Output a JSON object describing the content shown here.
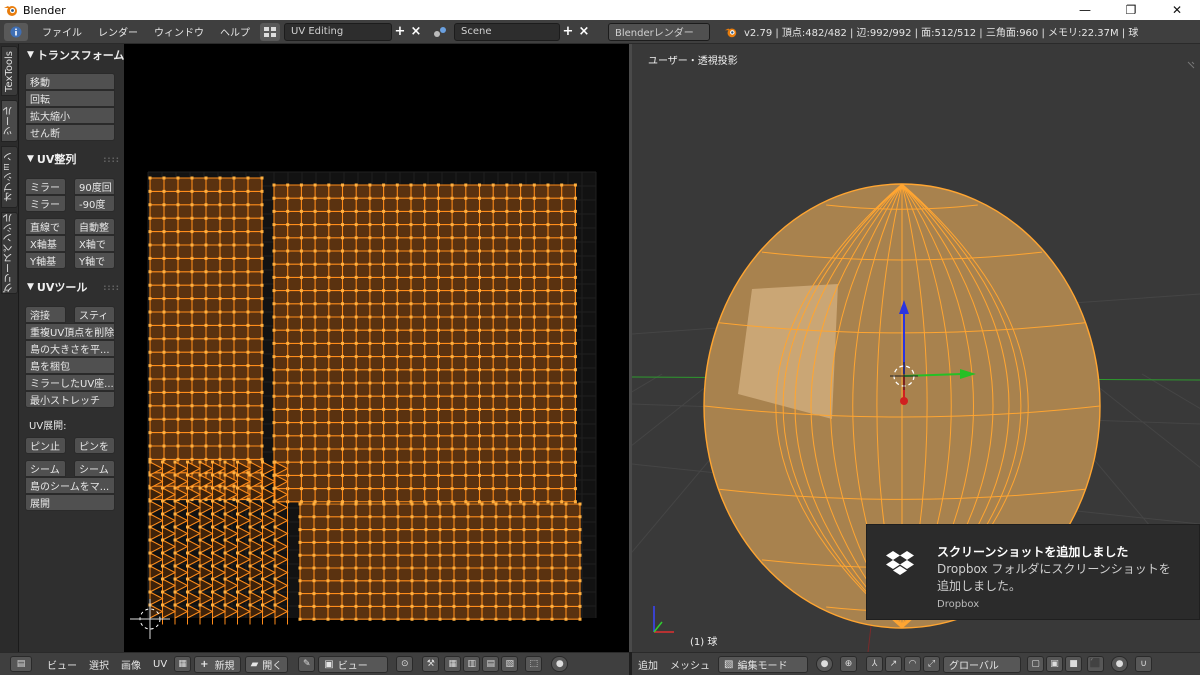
{
  "window": {
    "title": "Blender",
    "minimize": "—",
    "maximize": "❐",
    "close": "✕"
  },
  "menubar": {
    "items": [
      "ファイル",
      "レンダー",
      "ウィンドウ",
      "ヘルプ"
    ],
    "screen_layout": "UV Editing",
    "scene": "Scene",
    "engine": "Blenderレンダー",
    "stats": "v2.79 | 頂点:482/482 | 辺:992/992 | 面:512/512 | 三角面:960 | メモリ:22.37M | 球"
  },
  "tabs": [
    "TexTools",
    "ツール",
    "オプション",
    "グリースペンシル"
  ],
  "shelf": {
    "transform": {
      "title": "トランスフォーム",
      "buttons": [
        "移動",
        "回転",
        "拡大縮小",
        "せん断"
      ]
    },
    "uv_align": {
      "title": "UV整列",
      "buttons": [
        "ミラー",
        "90度回",
        "ミラー",
        "-90度",
        "直線で",
        "自動整",
        "X軸基",
        "X軸で",
        "Y軸基",
        "Y軸で"
      ]
    },
    "uv_tools": {
      "title": "UVツール",
      "buttons": [
        "溶接",
        "スティ",
        "重複UV頂点を削除",
        "島の大きさを平...",
        "島を梱包",
        "ミラーしたUV座...",
        "最小ストレッチ"
      ],
      "unwrap_label": "UV展開:",
      "unwrap_buttons": [
        "ピン止",
        "ピンを",
        "シーム",
        "シーム",
        "島のシームをマ...",
        "展開"
      ]
    }
  },
  "viewport": {
    "view_name": "ユーザー・透視投影",
    "object_label": "(1) 球"
  },
  "uv_footer": {
    "menus": [
      "ビュー",
      "選択",
      "画像",
      "UV"
    ],
    "new_label": "新規",
    "open_label": "開く",
    "view_mode": "ビュー"
  },
  "vp_footer": {
    "menus": [
      "追加",
      "メッシュ"
    ],
    "mode": "編集モード",
    "orientation": "グローバル"
  },
  "toast": {
    "title": "スクリーンショットを追加しました",
    "body": "Dropbox フォルダにスクリーンショットを追加しました。",
    "source": "Dropbox"
  },
  "colors": {
    "uv_orange": "#ff8c1a",
    "sphere_fill": "#a8824e",
    "sphere_edge": "#ffa531",
    "header_bg": "#3f3f3f"
  }
}
